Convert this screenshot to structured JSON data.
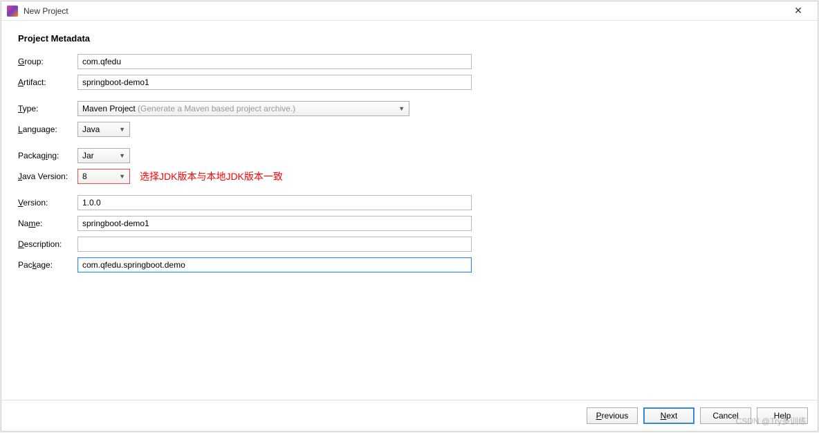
{
  "window": {
    "title": "New Project"
  },
  "section": {
    "title": "Project Metadata"
  },
  "labels": {
    "group": "Group:",
    "artifact": "Artifact:",
    "type": "Type:",
    "language": "Language:",
    "packaging": "Packaging:",
    "javaVersion": "Java Version:",
    "version": "Version:",
    "name": "Name:",
    "description": "Description:",
    "package": "Package:"
  },
  "values": {
    "group": "com.qfedu",
    "artifact": "springboot-demo1",
    "typeMain": "Maven Project",
    "typeHint": " (Generate a Maven based project archive.)",
    "language": "Java",
    "packaging": "Jar",
    "javaVersion": "8",
    "version": "1.0.0",
    "name": "springboot-demo1",
    "description": "",
    "package": "com.qfedu.springboot.demo"
  },
  "annotation": {
    "jdkNote": "选择JDK版本与本地JDK版本一致"
  },
  "buttons": {
    "previous": "Previous",
    "next": "Next",
    "cancel": "Cancel",
    "help": "Help"
  },
  "watermark": "CSDN @Try多训练"
}
